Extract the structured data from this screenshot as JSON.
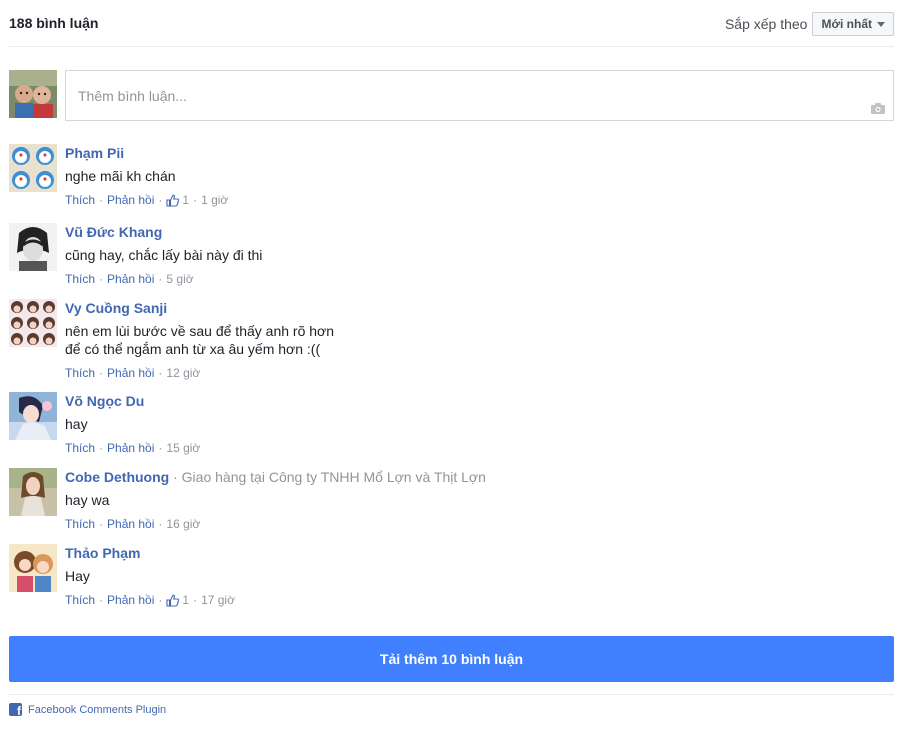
{
  "header": {
    "count_label": "188 bình luận",
    "sort_label": "Sắp xếp theo",
    "sort_value": "Mới nhất"
  },
  "composer": {
    "placeholder": "Thêm bình luận..."
  },
  "comments": [
    {
      "name": "Phạm Pii",
      "work": "",
      "text": [
        "nghe mãi kh chán"
      ],
      "like": "Thích",
      "reply": "Phản hồi",
      "likes": "1",
      "time": "1 giờ"
    },
    {
      "name": "Vũ Đức Khang",
      "work": "",
      "text": [
        "cũng hay, chắc lấy bài này đi thi"
      ],
      "like": "Thích",
      "reply": "Phản hồi",
      "likes": "",
      "time": "5 giờ"
    },
    {
      "name": "Vy Cuồng Sanji",
      "work": "",
      "text": [
        "nên em lùi bước về sau để thấy anh rõ hơn",
        "để có thể ngắm anh từ xa âu yếm hơn :(("
      ],
      "like": "Thích",
      "reply": "Phản hồi",
      "likes": "",
      "time": "12 giờ"
    },
    {
      "name": "Võ Ngọc Du",
      "work": "",
      "text": [
        "hay"
      ],
      "like": "Thích",
      "reply": "Phản hồi",
      "likes": "",
      "time": "15 giờ"
    },
    {
      "name": "Cobe Dethuong",
      "work": "Giao hàng tại Công ty TNHH Mổ Lợn và Thịt Lợn",
      "text": [
        "hay wa"
      ],
      "like": "Thích",
      "reply": "Phản hồi",
      "likes": "",
      "time": "16 giờ"
    },
    {
      "name": "Thảo Phạm",
      "work": "",
      "text": [
        "Hay"
      ],
      "like": "Thích",
      "reply": "Phản hồi",
      "likes": "1",
      "time": "17 giờ"
    }
  ],
  "load_more": {
    "label": "Tải thêm 10 bình luận"
  },
  "footer": {
    "label": "Facebook Comments Plugin"
  },
  "colors": {
    "link": "#4267b2",
    "button": "#4080ff",
    "muted": "#90949c"
  }
}
